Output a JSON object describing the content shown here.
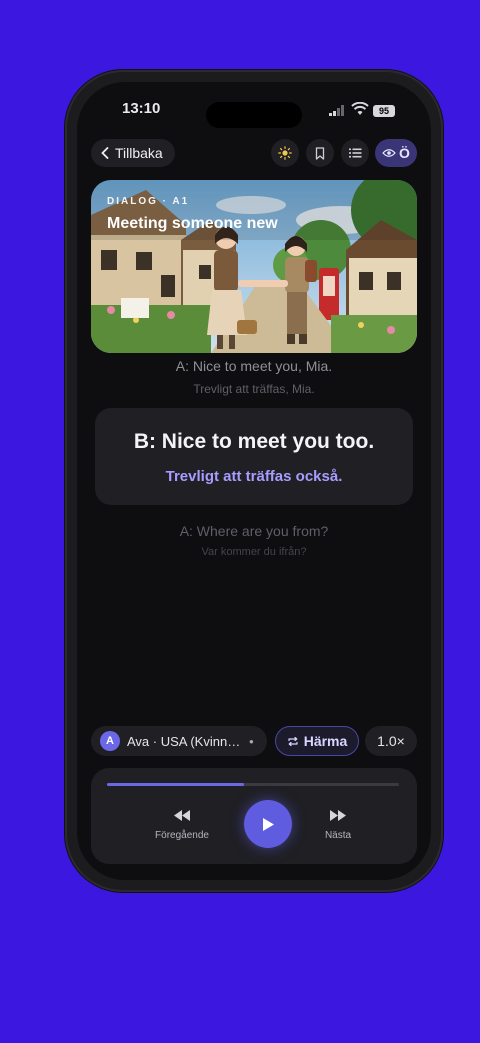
{
  "status": {
    "time": "13:10",
    "battery": "95"
  },
  "nav": {
    "back_label": "Tillbaka",
    "eye_label": "Ö"
  },
  "hero": {
    "tag": "DIALOG · A1",
    "title": "Meeting someone new"
  },
  "dialog": {
    "prev": {
      "text": "A: Nice to meet you, Mia.",
      "translation": "Trevligt att träffas, Mia."
    },
    "current": {
      "text": "B: Nice to meet you too.",
      "translation": "Trevligt att träffas också."
    },
    "next": {
      "text": "A: Where are you from?",
      "translation": "Var kommer du ifrån?"
    }
  },
  "controls": {
    "voice_initial": "A",
    "voice_label": "Ava · USA (Kvinnlig)",
    "mimic_label": "Härma",
    "speed_label": "1.0×"
  },
  "player": {
    "progress": 0.47,
    "prev_label": "Föregående",
    "next_label": "Nästa"
  },
  "colors": {
    "accent": "#5f5ce0",
    "background": "#3b17e0",
    "highlight_text": "#a89cff"
  }
}
